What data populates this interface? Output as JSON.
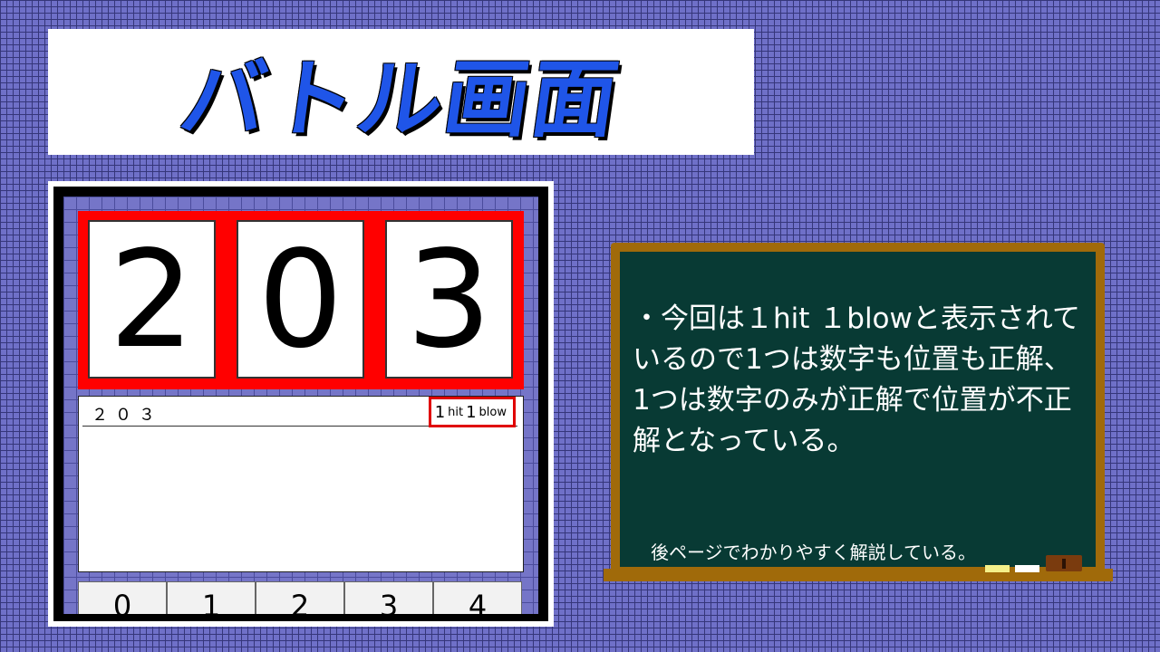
{
  "title": "バトル画面",
  "phone": {
    "digits": [
      "2",
      "0",
      "3"
    ],
    "history": [
      {
        "guess": "２０３",
        "hit_num": "1",
        "hit_label": "hit",
        "blow_num": "1",
        "blow_label": "blow"
      }
    ],
    "keys": [
      "0",
      "1",
      "2",
      "3",
      "4"
    ]
  },
  "board": {
    "text": "・今回は１hit １blowと表示されているので1つは数字も位置も正解、1つは数字のみが正解で位置が不正解となっている。",
    "note": "後ページでわかりやすく解説している。"
  },
  "colors": {
    "background": "#6f70c8",
    "title_text": "#1f55e8",
    "guess_panel": "#ff0000",
    "board": "#083a34",
    "board_frame": "#a06a0a"
  }
}
